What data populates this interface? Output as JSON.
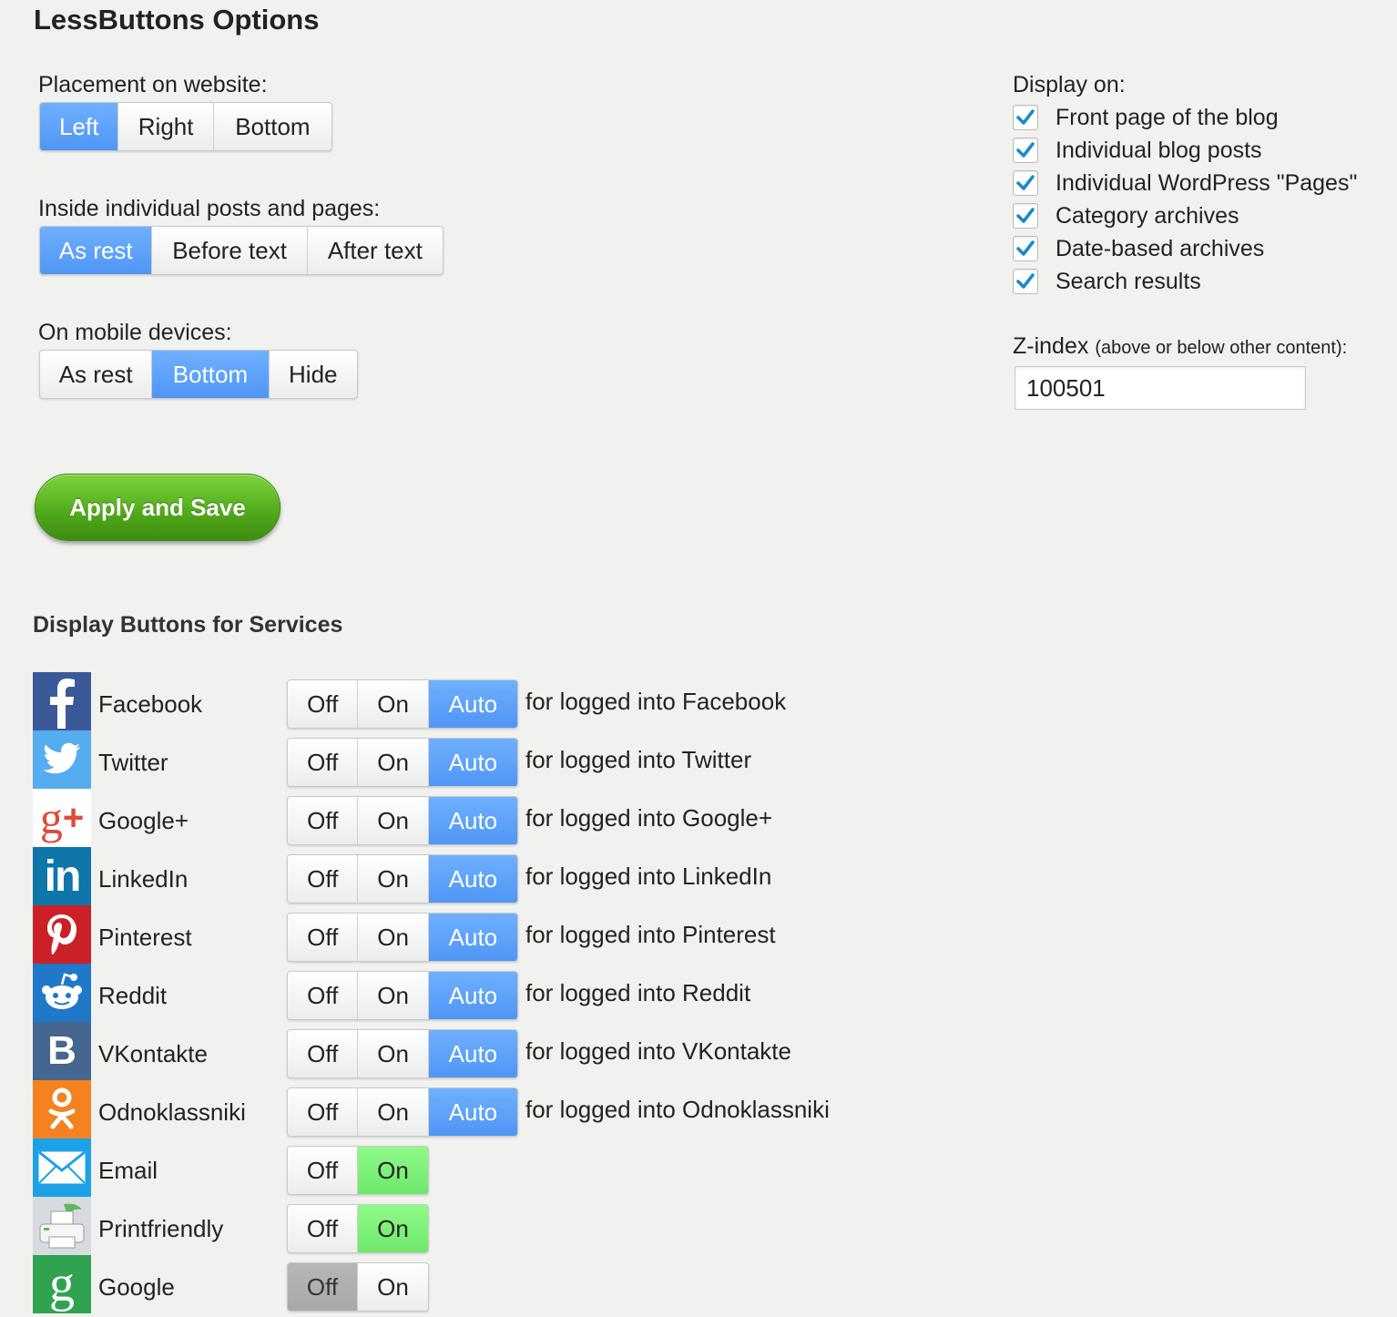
{
  "page": {
    "title": "LessButtons Options"
  },
  "placement": {
    "label": "Placement on website:",
    "options": [
      "Left",
      "Right",
      "Bottom"
    ],
    "selected": "Left"
  },
  "inside": {
    "label": "Inside individual posts and pages:",
    "options": [
      "As rest",
      "Before text",
      "After text"
    ],
    "selected": "As rest"
  },
  "mobile": {
    "label": "On mobile devices:",
    "options": [
      "As rest",
      "Bottom",
      "Hide"
    ],
    "selected": "Bottom"
  },
  "display_on": {
    "label": "Display on:",
    "items": [
      {
        "label": "Front page of the blog",
        "checked": true
      },
      {
        "label": "Individual blog posts",
        "checked": true
      },
      {
        "label": "Individual WordPress \"Pages\"",
        "checked": true
      },
      {
        "label": "Category archives",
        "checked": true
      },
      {
        "label": "Date-based archives",
        "checked": true
      },
      {
        "label": "Search results",
        "checked": true
      }
    ]
  },
  "zindex": {
    "label": "Z-index",
    "hint": "(above or below other content):",
    "value": "100501"
  },
  "apply_button": {
    "label": "Apply and Save"
  },
  "services": {
    "title": "Display Buttons for Services",
    "items": [
      {
        "name": "Facebook",
        "icon": "facebook-icon",
        "color": "#3b5998",
        "options": [
          "Off",
          "On",
          "Auto"
        ],
        "selected": "Auto",
        "note": "for logged into Facebook"
      },
      {
        "name": "Twitter",
        "icon": "twitter-icon",
        "color": "#55acee",
        "options": [
          "Off",
          "On",
          "Auto"
        ],
        "selected": "Auto",
        "note": "for logged into Twitter"
      },
      {
        "name": "Google+",
        "icon": "google-plus-icon",
        "color": "#ffffff",
        "options": [
          "Off",
          "On",
          "Auto"
        ],
        "selected": "Auto",
        "note": "for logged into Google+"
      },
      {
        "name": "LinkedIn",
        "icon": "linkedin-icon",
        "color": "#0e76a8",
        "options": [
          "Off",
          "On",
          "Auto"
        ],
        "selected": "Auto",
        "note": "for logged into LinkedIn"
      },
      {
        "name": "Pinterest",
        "icon": "pinterest-icon",
        "color": "#cb2027",
        "options": [
          "Off",
          "On",
          "Auto"
        ],
        "selected": "Auto",
        "note": "for logged into Pinterest"
      },
      {
        "name": "Reddit",
        "icon": "reddit-icon",
        "color": "#1f78c8",
        "options": [
          "Off",
          "On",
          "Auto"
        ],
        "selected": "Auto",
        "note": "for logged into Reddit"
      },
      {
        "name": "VKontakte",
        "icon": "vkontakte-icon",
        "color": "#45668e",
        "options": [
          "Off",
          "On",
          "Auto"
        ],
        "selected": "Auto",
        "note": "for logged into VKontakte"
      },
      {
        "name": "Odnoklassniki",
        "icon": "odnoklassniki-icon",
        "color": "#f58220",
        "options": [
          "Off",
          "On",
          "Auto"
        ],
        "selected": "Auto",
        "note": "for logged into Odnoklassniki"
      },
      {
        "name": "Email",
        "icon": "email-icon",
        "color": "#1da1e6",
        "options": [
          "Off",
          "On"
        ],
        "selected": "On",
        "note": ""
      },
      {
        "name": "Printfriendly",
        "icon": "printer-icon",
        "color": "#d7dbe0",
        "options": [
          "Off",
          "On"
        ],
        "selected": "On",
        "note": ""
      },
      {
        "name": "Google",
        "icon": "google-bookmarks-icon",
        "color": "#2fa350",
        "options": [
          "Off",
          "On"
        ],
        "selected": "Off",
        "note": ""
      }
    ]
  },
  "colors": {
    "accent_blue": "#4f96f5",
    "accent_green": "#6ee86a",
    "checkmark": "#1a88c9",
    "apply_green": "#4fa81a"
  }
}
